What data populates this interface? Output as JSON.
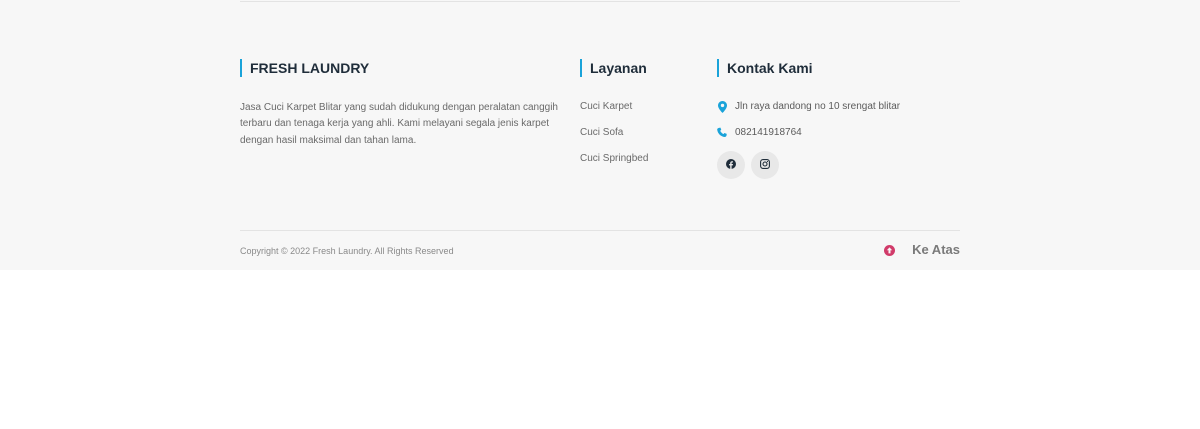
{
  "about": {
    "title": "FRESH LAUNDRY",
    "text": "Jasa Cuci Karpet Blitar yang sudah didukung dengan peralatan canggih terbaru dan tenaga kerja yang ahli. Kami melayani segala jenis karpet dengan hasil maksimal dan tahan lama."
  },
  "services": {
    "title": "Layanan",
    "items": [
      {
        "label": "Cuci Karpet"
      },
      {
        "label": "Cuci Sofa"
      },
      {
        "label": "Cuci Springbed"
      }
    ]
  },
  "contact": {
    "title": "Kontak Kami",
    "address": "Jln raya dandong no 10 srengat blitar",
    "phone": "082141918764",
    "social": [
      {
        "icon": "facebook-icon"
      },
      {
        "icon": "instagram-icon"
      }
    ]
  },
  "footer_bottom": {
    "copyright": "Copyright © 2022 Fresh Laundry. All Rights Reserved",
    "back_to_top": "Ke Atas"
  },
  "colors": {
    "accent": "#1aa3d9",
    "up_icon": "#d13b6a",
    "background": "#f7f7f7"
  }
}
